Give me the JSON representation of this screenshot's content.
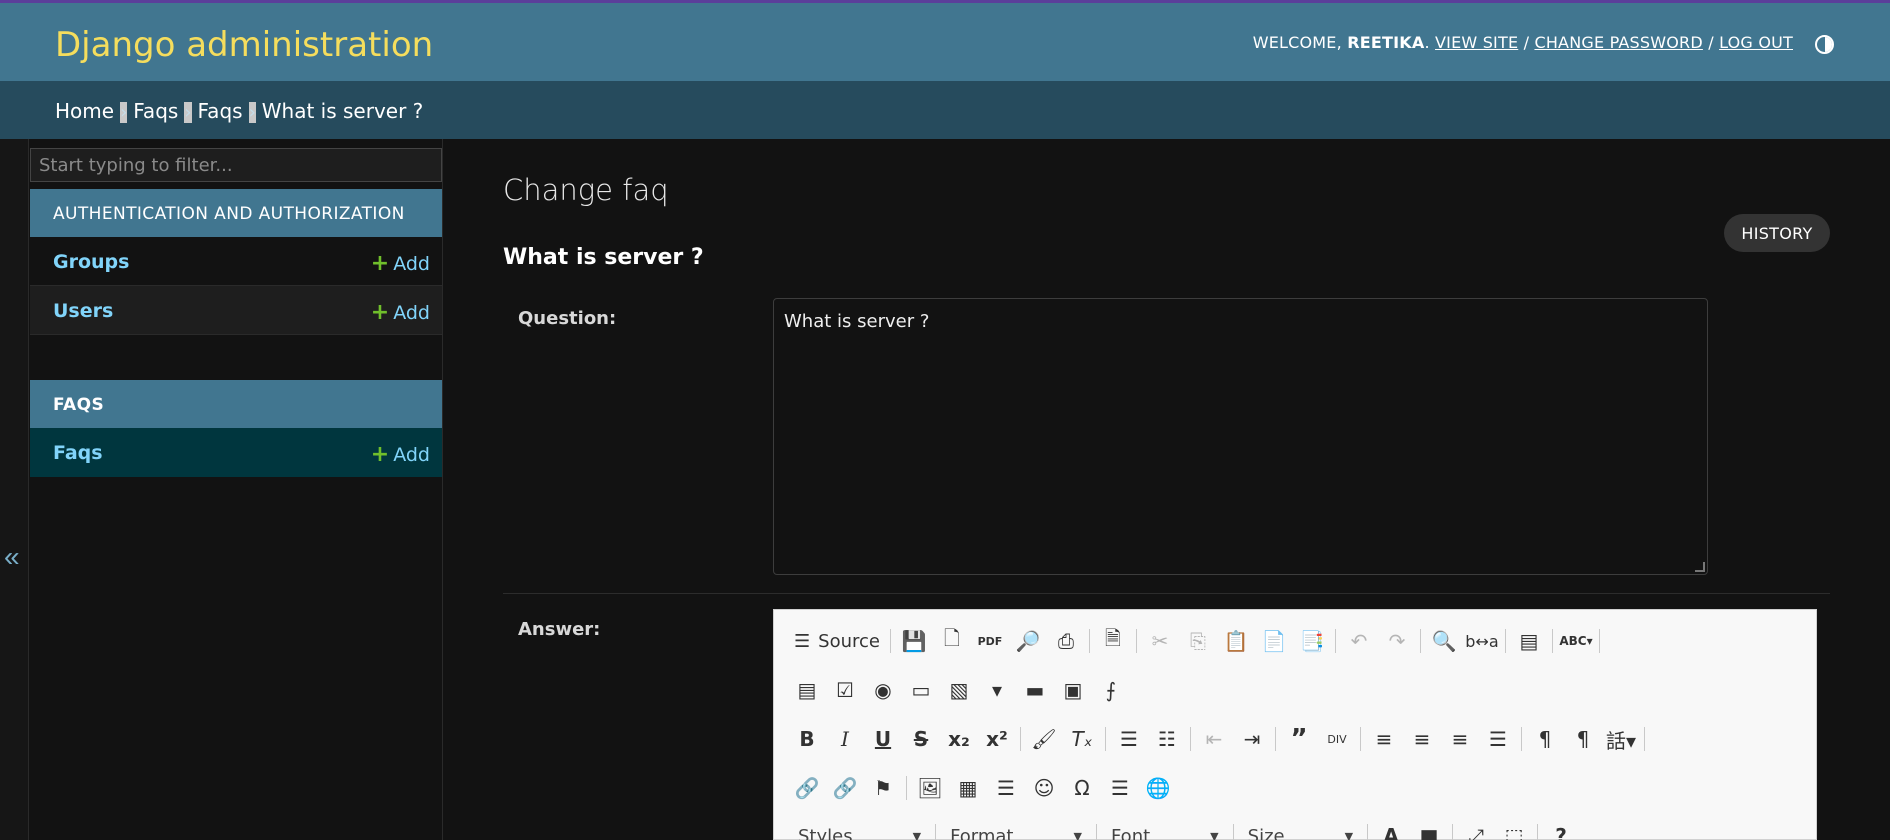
{
  "header": {
    "brand": "Django administration",
    "welcome": "WELCOME,",
    "username": "REETIKA",
    "view_site": "VIEW SITE",
    "change_password": "CHANGE PASSWORD",
    "log_out": "LOG OUT",
    "slash": "/",
    "accent_color": "#417690",
    "brand_color": "#f5dd5d"
  },
  "breadcrumbs": {
    "items": [
      "Home",
      "Faqs",
      "Faqs",
      "What is server ?"
    ],
    "separator": "›"
  },
  "sidebar": {
    "collapse_glyph": "«",
    "filter_placeholder": "Start typing to filter...",
    "apps": [
      {
        "caption": "AUTHENTICATION AND AUTHORIZATION",
        "models": [
          {
            "name": "Groups",
            "add": "Add"
          },
          {
            "name": "Users",
            "add": "Add"
          }
        ]
      },
      {
        "caption": "FAQS",
        "models": [
          {
            "name": "Faqs",
            "add": "Add",
            "current": true
          }
        ]
      }
    ]
  },
  "content": {
    "page_title": "Change faq",
    "history_button": "HISTORY",
    "object_title": "What is server ?",
    "question_label": "Question:",
    "question_value": "What is server ?",
    "answer_label": "Answer:"
  },
  "editor": {
    "source_label": "Source",
    "combos": [
      "Styles",
      "Format",
      "Font",
      "Size"
    ],
    "row1_icons": [
      "source-icon",
      "save-icon",
      "new-page-icon",
      "pdf-icon",
      "preview-icon",
      "print-icon",
      "templates-icon",
      "cut-icon",
      "copy-icon",
      "paste-icon",
      "paste-text-icon",
      "paste-word-icon",
      "undo-icon",
      "redo-icon",
      "find-icon",
      "replace-icon",
      "select-all-icon",
      "spellcheck-icon"
    ],
    "row2_icons": [
      "form-icon",
      "checkbox-icon",
      "radio-icon",
      "textfield-icon",
      "textarea-icon",
      "select-icon",
      "button-icon",
      "image-button-icon",
      "hidden-field-icon"
    ],
    "row3_icons": [
      "bold-icon",
      "italic-icon",
      "underline-icon",
      "strike-icon",
      "subscript-icon",
      "superscript-icon",
      "copy-format-icon",
      "remove-format-icon",
      "numbered-list-icon",
      "bulleted-list-icon",
      "outdent-icon",
      "indent-icon",
      "blockquote-icon",
      "div-icon",
      "align-left-icon",
      "align-center-icon",
      "align-right-icon",
      "justify-icon",
      "ltr-icon",
      "rtl-icon",
      "language-icon"
    ],
    "row4_icons": [
      "link-icon",
      "unlink-icon",
      "anchor-icon",
      "image-icon",
      "table-icon",
      "horizontal-line-icon",
      "smiley-icon",
      "special-char-icon",
      "page-break-icon",
      "iframe-icon"
    ]
  }
}
